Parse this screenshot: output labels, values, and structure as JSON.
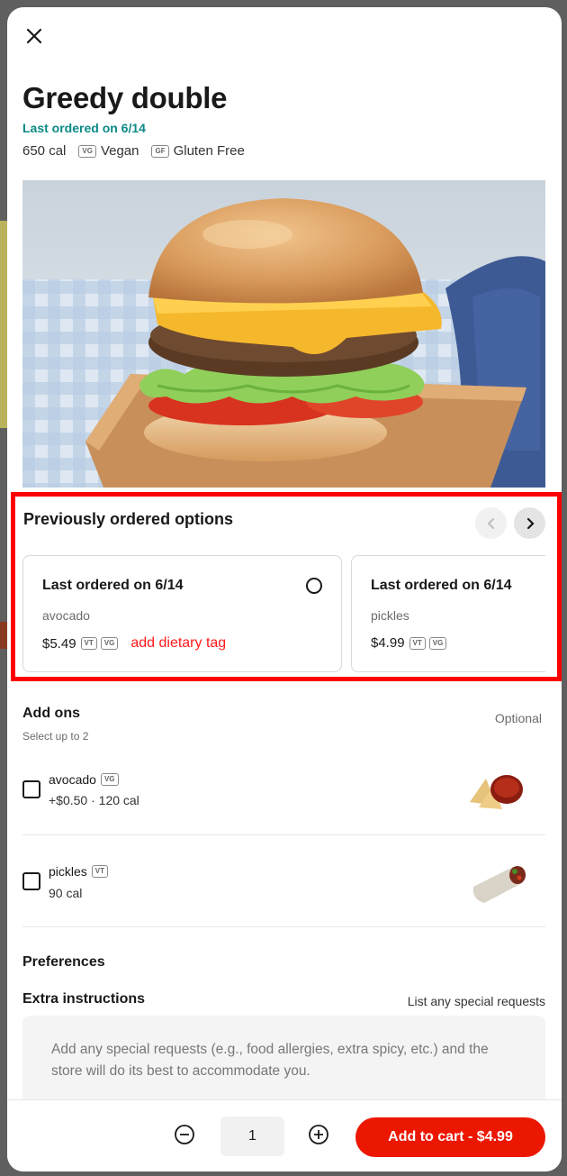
{
  "item": {
    "title": "Greedy double",
    "last_ordered": "Last ordered on 6/14",
    "calories": "650 cal",
    "dietary": [
      {
        "tag": "VG",
        "label": "Vegan"
      },
      {
        "tag": "GF",
        "label": "Gluten Free"
      }
    ]
  },
  "previous_options": {
    "title": "Previously ordered options",
    "cards": [
      {
        "title": "Last ordered on 6/14",
        "item": "avocado",
        "price": "$5.49",
        "tags": [
          "VT",
          "VG"
        ],
        "note": "add dietary tag"
      },
      {
        "title": "Last ordered on 6/14",
        "item": "pickles",
        "price": "$4.99",
        "tags": [
          "VT",
          "VG"
        ]
      }
    ]
  },
  "addons": {
    "title": "Add ons",
    "subtitle": "Select up to 2",
    "optional_label": "Optional",
    "items": [
      {
        "name": "avocado",
        "tag": "VG",
        "detail": "+$0.50 · 120 cal"
      },
      {
        "name": "pickles",
        "tag": "VT",
        "detail": "90 cal"
      }
    ]
  },
  "preferences": {
    "title": "Preferences",
    "instructions_title": "Extra instructions",
    "instructions_hint": "List any special requests",
    "instructions_placeholder": "Add any special requests (e.g., food allergies, extra spicy, etc.) and the store will do its best to accommodate you."
  },
  "footer": {
    "quantity": "1",
    "add_to_cart_label": "Add to cart - $4.99"
  },
  "colors": {
    "accent": "#eb1700",
    "teal": "#0b8a86",
    "highlight": "#ff0000"
  }
}
